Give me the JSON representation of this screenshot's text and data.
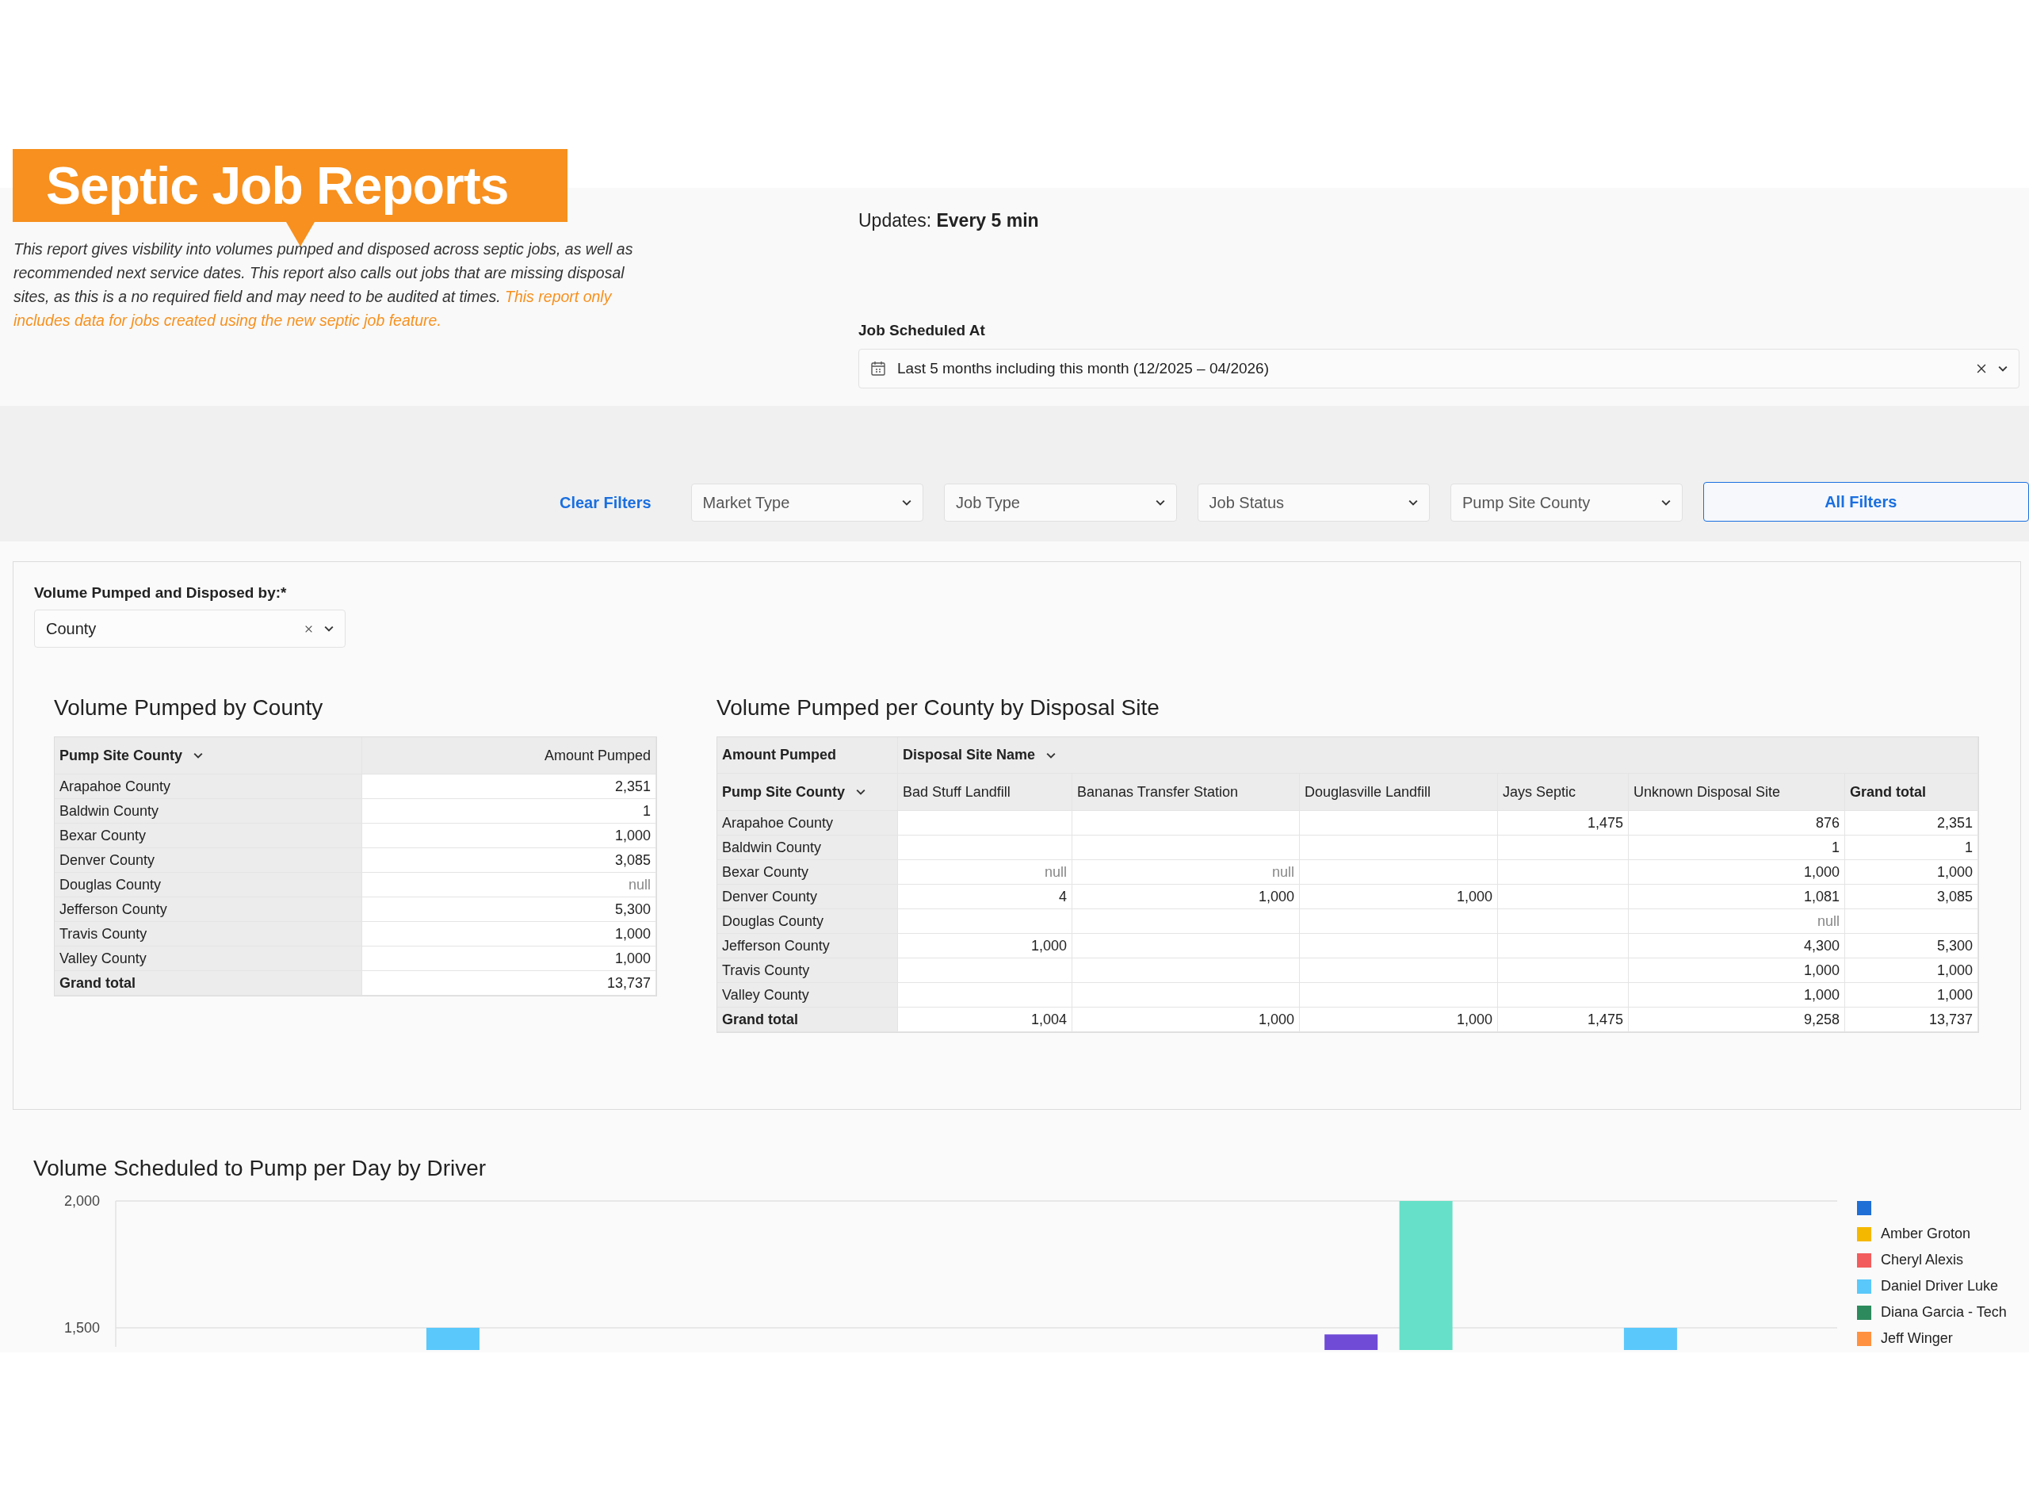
{
  "banner": {
    "title": "Septic Job Reports"
  },
  "description": {
    "text": "This report gives visbility into volumes pumped and disposed across septic jobs, as well as recommended next service dates. This report also calls out jobs that are missing disposal sites, as this is a no required field and may need to be audited at times.",
    "note": "This report only includes data for jobs created using the new septic job feature."
  },
  "updates": "Updates: **Every 5 min**",
  "job_scheduled": {
    "label": "Job Scheduled At",
    "value": "Last 5 months including this month (12/2025 – 04/2026)"
  },
  "filters": {
    "clear": "Clear Filters",
    "dropdowns": [
      "Market Type",
      "Job Type",
      "Job Status",
      "Pump Site County"
    ],
    "all": "All Filters"
  },
  "grouping": {
    "label": "Volume Pumped and Disposed by:*",
    "value": "County"
  },
  "county_table": {
    "title": "Volume Pumped by County",
    "columns": [
      "Pump Site County",
      "Amount Pumped"
    ],
    "rows": [
      {
        "kind": "row",
        "name": "Arapahoe County",
        "value": "2,351"
      },
      {
        "kind": "row",
        "name": "Baldwin County",
        "value": "1"
      },
      {
        "kind": "row",
        "name": "Bexar County",
        "value": "1,000"
      },
      {
        "kind": "row",
        "name": "Denver County",
        "value": "3,085"
      },
      {
        "kind": "row",
        "name": "Douglas County",
        "value": "null"
      },
      {
        "kind": "row",
        "name": "Jefferson County",
        "value": "5,300"
      },
      {
        "kind": "row",
        "name": "Travis County",
        "value": "1,000"
      },
      {
        "kind": "row",
        "name": "Valley County",
        "value": "1,000"
      },
      {
        "kind": "total",
        "name": "Grand total",
        "value": "13,737"
      }
    ]
  },
  "site_table": {
    "title": "Volume Pumped per County by Disposal Site",
    "corner": "Amount Pumped",
    "group_header": "Disposal Site Name",
    "row_header": "Pump Site County",
    "columns": [
      "Bad Stuff Landfill",
      "Bananas Transfer Station",
      "Douglasville Landfill",
      "Jays Septic",
      "Unknown Disposal Site",
      "Grand total"
    ],
    "rows": [
      {
        "kind": "row",
        "name": "Arapahoe County",
        "cells": [
          null,
          null,
          null,
          "1,475",
          "876",
          "2,351"
        ]
      },
      {
        "kind": "row",
        "name": "Baldwin County",
        "cells": [
          null,
          null,
          null,
          null,
          "1",
          "1"
        ]
      },
      {
        "kind": "row",
        "name": "Bexar County",
        "cells": [
          "null",
          "null",
          null,
          null,
          "1,000",
          "1,000"
        ]
      },
      {
        "kind": "row",
        "name": "Denver County",
        "cells": [
          "4",
          "1,000",
          "1,000",
          null,
          "1,081",
          "3,085"
        ]
      },
      {
        "kind": "row",
        "name": "Douglas County",
        "cells": [
          null,
          null,
          null,
          null,
          "null",
          null
        ]
      },
      {
        "kind": "row",
        "name": "Jefferson County",
        "cells": [
          "1,000",
          null,
          null,
          null,
          "4,300",
          "5,300"
        ]
      },
      {
        "kind": "row",
        "name": "Travis County",
        "cells": [
          null,
          null,
          null,
          null,
          "1,000",
          "1,000"
        ]
      },
      {
        "kind": "row",
        "name": "Valley County",
        "cells": [
          null,
          null,
          null,
          null,
          "1,000",
          "1,000"
        ]
      },
      {
        "kind": "total",
        "name": "Grand total",
        "cells": [
          "1,004",
          "1,000",
          "1,000",
          "1,475",
          "9,258",
          "13,737"
        ]
      }
    ]
  },
  "driver_chart": {
    "title": "Volume Scheduled to Pump per Day by Driver",
    "chart_data": {
      "type": "bar",
      "ylim": [
        1425,
        2000
      ],
      "yticks": [
        {
          "value": 1500,
          "label": "1,500"
        },
        {
          "value": 2000,
          "label": "2,000"
        }
      ],
      "series": [
        {
          "color": "#5ac8fa",
          "values": [
            null,
            null,
            null,
            null,
            1500,
            null,
            null,
            null,
            null,
            null,
            null,
            null,
            null,
            null,
            null,
            null,
            null,
            null,
            null,
            null,
            1500,
            null,
            null
          ]
        },
        {
          "color": "#6f4bd6",
          "values": [
            null,
            null,
            null,
            null,
            null,
            null,
            null,
            null,
            null,
            null,
            null,
            null,
            null,
            null,
            null,
            null,
            1474,
            null,
            null,
            null,
            null,
            null,
            null
          ]
        },
        {
          "color": "#66e0c8",
          "values": [
            null,
            null,
            null,
            null,
            null,
            null,
            null,
            null,
            null,
            null,
            null,
            null,
            null,
            null,
            null,
            null,
            null,
            2000,
            null,
            null,
            null,
            null,
            null
          ]
        }
      ]
    },
    "legend": [
      {
        "color": "#1f6fd6"
      },
      {
        "label": "Amber Groton",
        "color": "#f5b800"
      },
      {
        "label": "Cheryl Alexis",
        "color": "#f25c5c"
      },
      {
        "label": "Daniel Driver Luke",
        "color": "#5ac8fa"
      },
      {
        "label": "Diana Garcia - Tech",
        "color": "#2d8a5c"
      },
      {
        "label": "Jeff Winger",
        "color": "#ff9140"
      }
    ]
  }
}
